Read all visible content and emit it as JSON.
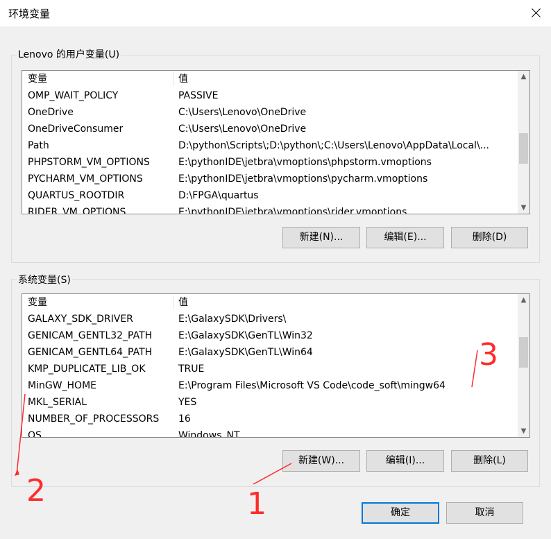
{
  "window": {
    "title": "环境变量"
  },
  "user_vars": {
    "legend": "Lenovo 的用户变量(U)",
    "headers": [
      "变量",
      "值"
    ],
    "rows": [
      [
        "OMP_WAIT_POLICY",
        "PASSIVE"
      ],
      [
        "OneDrive",
        "C:\\Users\\Lenovo\\OneDrive"
      ],
      [
        "OneDriveConsumer",
        "C:\\Users\\Lenovo\\OneDrive"
      ],
      [
        "Path",
        "D:\\python\\Scripts\\;D:\\python\\;C:\\Users\\Lenovo\\AppData\\Local\\..."
      ],
      [
        "PHPSTORM_VM_OPTIONS",
        "E:\\pythonIDE\\jetbra\\vmoptions\\phpstorm.vmoptions"
      ],
      [
        "PYCHARM_VM_OPTIONS",
        "E:\\pythonIDE\\jetbra\\vmoptions\\pycharm.vmoptions"
      ],
      [
        "QUARTUS_ROOTDIR",
        "D:\\FPGA\\quartus"
      ],
      [
        "RIDER_VM_OPTIONS",
        "E:\\pythonIDE\\jetbra\\vmoptions\\rider.vmoptions"
      ]
    ],
    "buttons": {
      "new": "新建(N)...",
      "edit": "编辑(E)...",
      "delete": "删除(D)"
    }
  },
  "system_vars": {
    "legend": "系统变量(S)",
    "headers": [
      "变量",
      "值"
    ],
    "rows": [
      [
        "GALAXY_SDK_DRIVER",
        "E:\\GalaxySDK\\Drivers\\"
      ],
      [
        "GENICAM_GENTL32_PATH",
        "E:\\GalaxySDK\\GenTL\\Win32"
      ],
      [
        "GENICAM_GENTL64_PATH",
        "E:\\GalaxySDK\\GenTL\\Win64"
      ],
      [
        "KMP_DUPLICATE_LIB_OK",
        "TRUE"
      ],
      [
        "MinGW_HOME",
        "E:\\Program Files\\Microsoft VS Code\\code_soft\\mingw64"
      ],
      [
        "MKL_SERIAL",
        "YES"
      ],
      [
        "NUMBER_OF_PROCESSORS",
        "16"
      ],
      [
        "OS",
        "Windows_NT"
      ]
    ],
    "buttons": {
      "new": "新建(W)...",
      "edit": "编辑(I)...",
      "delete": "删除(L)"
    }
  },
  "footer": {
    "ok": "确定",
    "cancel": "取消"
  },
  "annotations": {
    "n1": "1",
    "n2": "2",
    "n3": "3",
    "color": "#ff2b2b"
  }
}
